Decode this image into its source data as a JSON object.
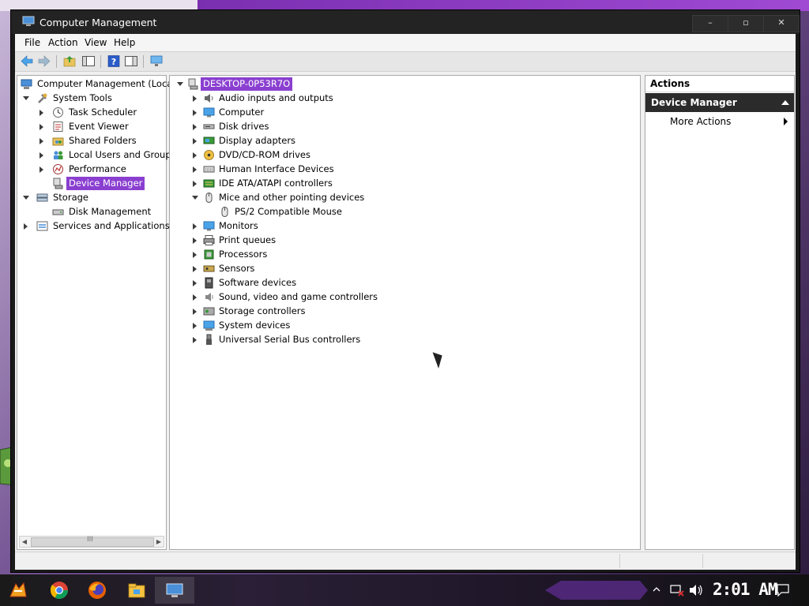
{
  "window": {
    "title": "Computer Management",
    "controls": {
      "minimize": "–",
      "maximize": "▫",
      "close": "✕"
    }
  },
  "menubar": [
    "File",
    "Action",
    "View",
    "Help"
  ],
  "left_tree": [
    {
      "label": "Computer Management (Local)",
      "icon": "computer-management-icon",
      "expander": "none"
    },
    {
      "label": "System Tools",
      "icon": "tools-icon",
      "expander": "expanded"
    },
    {
      "label": "Task Scheduler",
      "icon": "clock-icon",
      "expander": "collapsed"
    },
    {
      "label": "Event Viewer",
      "icon": "event-viewer-icon",
      "expander": "collapsed"
    },
    {
      "label": "Shared Folders",
      "icon": "shared-folder-icon",
      "expander": "collapsed"
    },
    {
      "label": "Local Users and Groups",
      "icon": "users-icon",
      "expander": "collapsed"
    },
    {
      "label": "Performance",
      "icon": "performance-icon",
      "expander": "collapsed"
    },
    {
      "label": "Device Manager",
      "icon": "device-manager-icon",
      "expander": "none",
      "selected": true
    },
    {
      "label": "Storage",
      "icon": "storage-icon",
      "expander": "expanded"
    },
    {
      "label": "Disk Management",
      "icon": "disk-icon",
      "expander": "none"
    },
    {
      "label": "Services and Applications",
      "icon": "services-icon",
      "expander": "collapsed"
    }
  ],
  "device_tree": {
    "root": "DESKTOP-0P53R7O",
    "items": [
      {
        "label": "Audio inputs and outputs",
        "icon": "speaker-icon",
        "expander": "collapsed"
      },
      {
        "label": "Computer",
        "icon": "monitor-icon",
        "expander": "collapsed"
      },
      {
        "label": "Disk drives",
        "icon": "disk-drive-icon",
        "expander": "collapsed"
      },
      {
        "label": "Display adapters",
        "icon": "display-adapter-icon",
        "expander": "collapsed"
      },
      {
        "label": "DVD/CD-ROM drives",
        "icon": "dvd-icon",
        "expander": "collapsed"
      },
      {
        "label": "Human Interface Devices",
        "icon": "hid-icon",
        "expander": "collapsed"
      },
      {
        "label": "IDE ATA/ATAPI controllers",
        "icon": "ide-icon",
        "expander": "collapsed"
      },
      {
        "label": "Mice and other pointing devices",
        "icon": "mouse-icon",
        "expander": "expanded"
      },
      {
        "label": "PS/2 Compatible Mouse",
        "icon": "mouse-icon",
        "expander": "none",
        "child": true
      },
      {
        "label": "Monitors",
        "icon": "monitor-icon",
        "expander": "collapsed"
      },
      {
        "label": "Print queues",
        "icon": "printer-icon",
        "expander": "collapsed"
      },
      {
        "label": "Processors",
        "icon": "processor-icon",
        "expander": "collapsed"
      },
      {
        "label": "Sensors",
        "icon": "sensor-icon",
        "expander": "collapsed"
      },
      {
        "label": "Software devices",
        "icon": "software-device-icon",
        "expander": "collapsed"
      },
      {
        "label": "Sound, video and game controllers",
        "icon": "sound-icon",
        "expander": "collapsed"
      },
      {
        "label": "Storage controllers",
        "icon": "storage-controller-icon",
        "expander": "collapsed"
      },
      {
        "label": "System devices",
        "icon": "system-devices-icon",
        "expander": "collapsed"
      },
      {
        "label": "Universal Serial Bus controllers",
        "icon": "usb-icon",
        "expander": "collapsed"
      }
    ]
  },
  "actions": {
    "header": "Actions",
    "section": "Device Manager",
    "item": "More Actions"
  },
  "left_scroll_glyph": "III",
  "taskbar": {
    "clock": "2:01 AM",
    "apps": [
      "start-icon",
      "chrome-icon",
      "firefox-icon",
      "file-explorer-icon",
      "computer-management-icon"
    ]
  },
  "colors": {
    "selection": "#8a3fd0",
    "titlebar": "#232323",
    "actions_section": "#2b2b2b"
  }
}
